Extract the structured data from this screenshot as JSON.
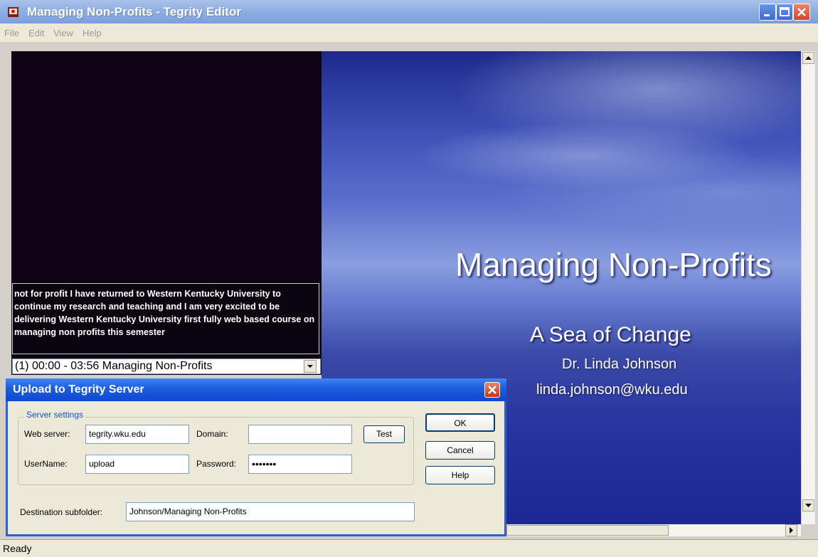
{
  "window": {
    "title": "Managing Non-Profits - Tegrity Editor"
  },
  "menu": {
    "file": "File",
    "edit": "Edit",
    "view": "View",
    "help": "Help"
  },
  "caption": {
    "text": "not for profit I have returned to Western Kentucky University to continue my research and teaching and I am very excited to be delivering Western Kentucky University first fully web based course on managing non profits this semester"
  },
  "chapter": {
    "selected": "(1) 00:00 - 03:56 Managing Non-Profits"
  },
  "slide": {
    "title": "Managing Non-Profits",
    "subtitle": "A Sea of Change",
    "author": "Dr. Linda Johnson",
    "email": "linda.johnson@wku.edu"
  },
  "status": {
    "text": "Ready"
  },
  "dialog": {
    "title": "Upload to Tegrity Server",
    "group_label": "Server settings",
    "web_server_label": "Web server:",
    "web_server_value": "tegrity.wku.edu",
    "domain_label": "Domain:",
    "domain_value": "",
    "username_label": "UserName:",
    "username_value": "upload",
    "password_label": "Password:",
    "password_value": "•••••••",
    "test_button": "Test",
    "ok_button": "OK",
    "cancel_button": "Cancel",
    "help_button": "Help",
    "destination_label": "Destination subfolder:",
    "destination_value": "Johnson/Managing Non-Profits"
  },
  "colors": {
    "titlebar": "#8eaee3",
    "dialog_title": "#1d5fe0",
    "slide_bg": "#3b4aa8"
  }
}
